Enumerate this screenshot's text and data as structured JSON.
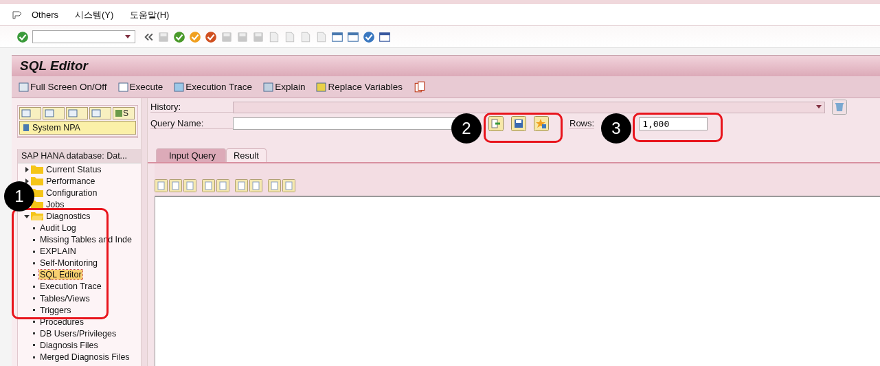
{
  "menu": [
    {
      "label": "Others"
    },
    {
      "label": "시스템(Y)"
    },
    {
      "label": "도움말(H)"
    }
  ],
  "title": "SQL Editor",
  "app_toolbar": [
    {
      "label": "Full Screen On/Off"
    },
    {
      "label": "Execute"
    },
    {
      "label": "Execution Trace"
    },
    {
      "label": "Explain"
    },
    {
      "label": "Replace Variables"
    }
  ],
  "nav": {
    "toolbar_label": "S",
    "system": "System NPA",
    "tree_title": "SAP HANA database: Dat...",
    "tree": [
      {
        "label": "Current Status",
        "expanded": false,
        "selected": false
      },
      {
        "label": "Performance",
        "expanded": false,
        "selected": false
      },
      {
        "label": "Configuration",
        "selected": false
      },
      {
        "label": "Jobs",
        "selected": false
      },
      {
        "label": "Diagnostics",
        "expanded": true,
        "selected": false,
        "children": [
          {
            "label": "Audit Log",
            "selected": false
          },
          {
            "label": "Missing Tables and Inde",
            "selected": false
          },
          {
            "label": "EXPLAIN",
            "selected": false
          },
          {
            "label": "Self-Monitoring",
            "selected": false
          },
          {
            "label": "SQL Editor",
            "selected": true
          },
          {
            "label": "Execution Trace",
            "selected": false
          },
          {
            "label": "Tables/Views",
            "selected": false
          },
          {
            "label": "Triggers",
            "selected": false
          },
          {
            "label": "Procedures",
            "selected": false
          },
          {
            "label": "DB Users/Privileges",
            "selected": false
          },
          {
            "label": "Diagnosis Files",
            "selected": false
          },
          {
            "label": "Merged Diagnosis Files",
            "selected": false
          }
        ]
      }
    ]
  },
  "query": {
    "history_label": "History:",
    "query_name_label": "Query Name:",
    "rows_label": "Rows:",
    "rows_value": "1,000"
  },
  "tabs": [
    {
      "label": "Input Query",
      "selected": true
    },
    {
      "label": "Result",
      "selected": false
    }
  ],
  "annotations": [
    {
      "label": "1"
    },
    {
      "label": "2"
    },
    {
      "label": "3"
    }
  ]
}
